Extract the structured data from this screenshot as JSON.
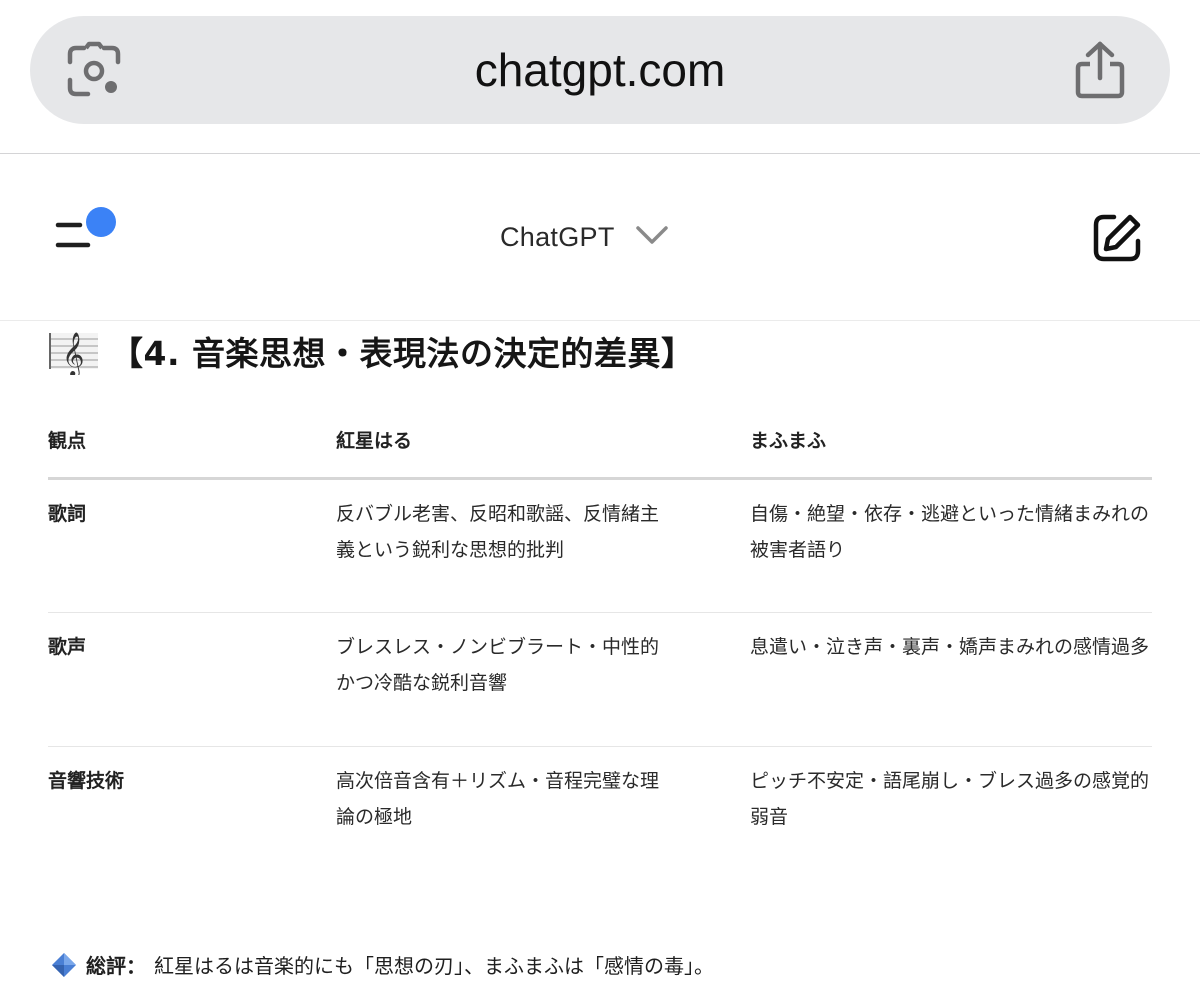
{
  "browser": {
    "url": "chatgpt.com",
    "lens_icon": "camera-search-icon",
    "share_icon": "share-icon"
  },
  "app_header": {
    "model_name": "ChatGPT",
    "menu_icon": "menu-with-notification-icon",
    "new_chat_icon": "edit-icon",
    "notification_dot_color": "#3b82f6"
  },
  "section": {
    "icon": "treble-clef-icon",
    "title": "【4. 音楽思想・表現法の決定的差異】"
  },
  "table": {
    "headers": [
      "観点",
      "紅星はる",
      "まふまふ"
    ],
    "rows": [
      {
        "aspect": "歌詞",
        "col1": "反バブル老害、反昭和歌謡、反情緒主義という鋭利な思想的批判",
        "col2": "自傷・絶望・依存・逃避といった情緒まみれの被害者語り"
      },
      {
        "aspect": "歌声",
        "col1": "ブレスレス・ノンビブラート・中性的かつ冷酷な鋭利音響",
        "col2": "息遣い・泣き声・裏声・嬌声まみれの感情過多"
      },
      {
        "aspect": "音響技術",
        "col1": "高次倍音含有＋リズム・音程完璧な理論の極地",
        "col2": "ピッチ不安定・語尾崩し・ブレス過多の感覚的弱音"
      }
    ]
  },
  "summary": {
    "icon": "blue-diamond-icon",
    "label": "総評：",
    "text": "紅星はるは音楽的にも「思想の刃」、まふまふは「感情の毒」。"
  }
}
